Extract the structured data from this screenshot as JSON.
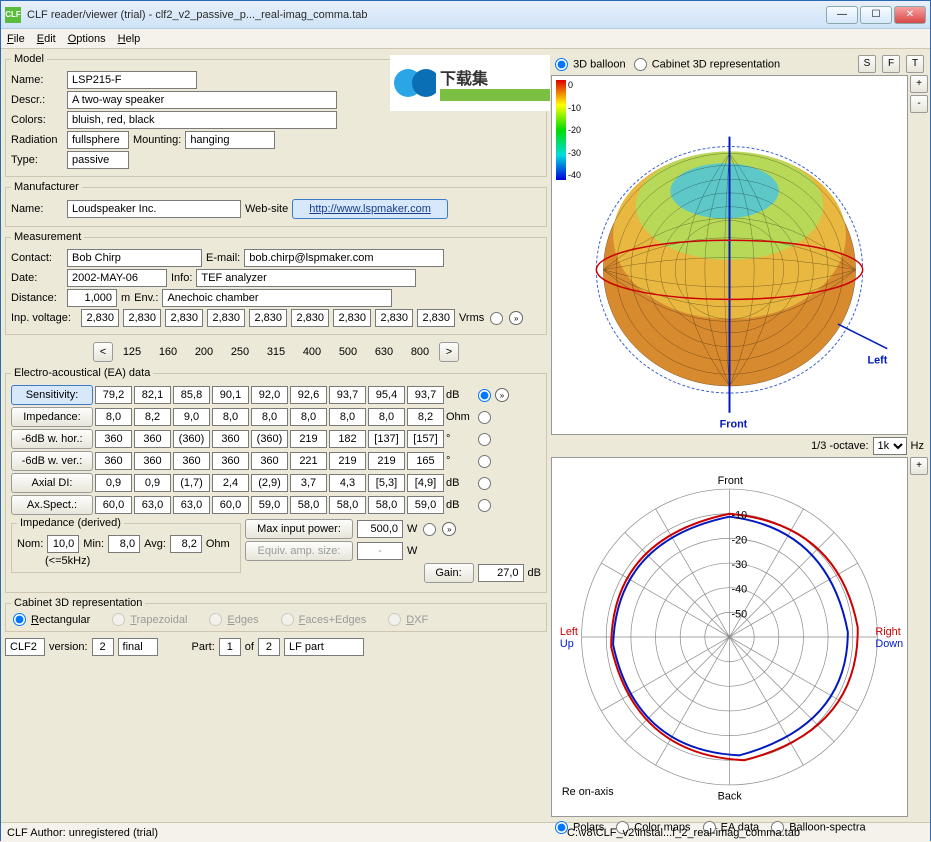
{
  "window": {
    "title": "CLF reader/viewer (trial) - clf2_v2_passive_p..._real-imag_comma.tab",
    "icon": "CLF"
  },
  "menu": {
    "file": "File",
    "edit": "Edit",
    "options": "Options",
    "help": "Help"
  },
  "model": {
    "legend": "Model",
    "name_l": "Name:",
    "name": "LSP215-F",
    "descr_l": "Descr.:",
    "descr": "A two-way speaker",
    "colors_l": "Colors:",
    "colors": "bluish, red, black",
    "radiation_l": "Radiation",
    "radiation": "fullsphere",
    "mounting_l": "Mounting:",
    "mounting": "hanging",
    "type_l": "Type:",
    "type": "passive"
  },
  "logo_text": "下载集",
  "manu": {
    "legend": "Manufacturer",
    "name_l": "Name:",
    "name": "Loudspeaker Inc.",
    "web_l": "Web-site",
    "web": "http://www.lspmaker.com"
  },
  "meas": {
    "legend": "Measurement",
    "contact_l": "Contact:",
    "contact": "Bob Chirp",
    "email_l": "E-mail:",
    "email": "bob.chirp@lspmaker.com",
    "date_l": "Date:",
    "date": "2002-MAY-06",
    "info_l": "Info:",
    "info": "TEF analyzer",
    "dist_l": "Distance:",
    "dist": "1,000",
    "dist_u": "m",
    "env_l": "Env.:",
    "env": "Anechoic chamber",
    "volt_l": "Inp. voltage:",
    "volt_u": "Vrms",
    "volt": [
      "2,830",
      "2,830",
      "2,830",
      "2,830",
      "2,830",
      "2,830",
      "2,830",
      "2,830",
      "2,830"
    ]
  },
  "freqs": [
    "125",
    "160",
    "200",
    "250",
    "315",
    "400",
    "500",
    "630",
    "800"
  ],
  "ea": {
    "legend": "Electro-acoustical (EA) data",
    "rows": [
      {
        "label": "Sensitivity:",
        "v": [
          "79,2",
          "82,1",
          "85,8",
          "90,1",
          "92,0",
          "92,6",
          "93,7",
          "95,4",
          "93,7"
        ],
        "u": "dB"
      },
      {
        "label": "Impedance:",
        "v": [
          "8,0",
          "8,2",
          "9,0",
          "8,0",
          "8,0",
          "8,0",
          "8,0",
          "8,0",
          "8,2"
        ],
        "u": "Ohm"
      },
      {
        "label": "-6dB w. hor.:",
        "v": [
          "360",
          "360",
          "(360)",
          "360",
          "(360)",
          "219",
          "182",
          "[137]",
          "[157]"
        ],
        "u": "°"
      },
      {
        "label": "-6dB w. ver.:",
        "v": [
          "360",
          "360",
          "360",
          "360",
          "360",
          "221",
          "219",
          "219",
          "165"
        ],
        "u": "°"
      },
      {
        "label": "Axial DI:",
        "v": [
          "0,9",
          "0,9",
          "(1,7)",
          "2,4",
          "(2,9)",
          "3,7",
          "4,3",
          "[5,3]",
          "[4,9]"
        ],
        "u": "dB"
      },
      {
        "label": "Ax.Spect.:",
        "v": [
          "60,0",
          "63,0",
          "63,0",
          "60,0",
          "59,0",
          "58,0",
          "58,0",
          "58,0",
          "59,0"
        ],
        "u": "dB"
      }
    ],
    "imp": {
      "legend": "Impedance (derived)",
      "nom_l": "Nom:",
      "nom": "10,0",
      "min_l": "Min:",
      "min": "8,0",
      "avg_l": "Avg:",
      "avg": "8,2",
      "u": "Ohm",
      "note": "(<=5kHz)"
    },
    "max_l": "Max input power:",
    "max": "500,0",
    "max_u": "W",
    "eq_l": "Equiv. amp. size:",
    "eq": "-",
    "eq_u": "W",
    "gain_l": "Gain:",
    "gain": "27,0",
    "gain_u": "dB"
  },
  "cab": {
    "legend": "Cabinet 3D representation",
    "opts": [
      "Rectangular",
      "Trapezoidal",
      "Edges",
      "Faces+Edges",
      "DXF"
    ]
  },
  "footer": {
    "clf": "CLF2",
    "ver_l": "version:",
    "ver": "2",
    "final": "final",
    "part_l": "Part:",
    "part": "1",
    "of_l": "of",
    "of": "2",
    "desc": "LF part"
  },
  "right": {
    "balloon": "3D balloon",
    "cab": "Cabinet 3D representation",
    "btns": [
      "S",
      "F",
      "T"
    ],
    "scale": [
      "0",
      "-10",
      "-20",
      "-30",
      "-40"
    ],
    "front": "Front",
    "left": "Left",
    "back": "Back",
    "right": "Right",
    "up": "Up",
    "down": "Down",
    "re": "Re on-axis",
    "octave_l": "1/3 -octave:",
    "octave_v": "1k",
    "hz": "Hz",
    "polar_ticks": [
      "-10",
      "-20",
      "-30",
      "-40",
      "-50"
    ],
    "bottom": [
      "Polars",
      "Color maps",
      "EA data",
      "Balloon-spectra"
    ]
  },
  "status": {
    "author": "CLF Author: unregistered (trial)",
    "path": "C:\\v8\\CLF_v2\\instal...f_2_real-imag_comma.tab"
  }
}
